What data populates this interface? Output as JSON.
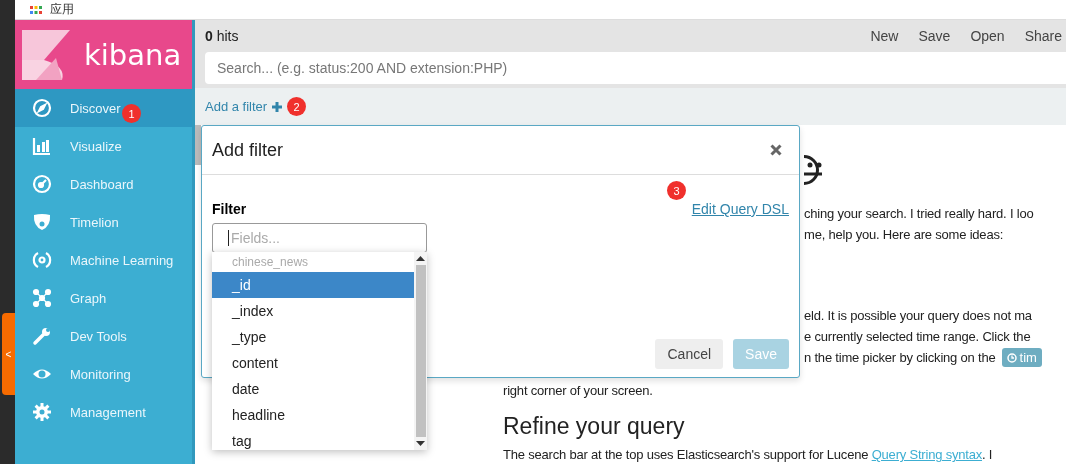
{
  "browser_bar": {
    "label": "应用"
  },
  "collapse_tab": {
    "label": "<"
  },
  "sidebar": {
    "logo": "kibana",
    "items": [
      {
        "label": "Discover",
        "selected": true,
        "badge": "1"
      },
      {
        "label": "Visualize",
        "selected": false
      },
      {
        "label": "Dashboard",
        "selected": false
      },
      {
        "label": "Timelion",
        "selected": false
      },
      {
        "label": "Machine Learning",
        "selected": false
      },
      {
        "label": "Graph",
        "selected": false
      },
      {
        "label": "Dev Tools",
        "selected": false
      },
      {
        "label": "Monitoring",
        "selected": false
      },
      {
        "label": "Management",
        "selected": false
      }
    ]
  },
  "top_bar": {
    "hits_count": "0",
    "hits_label": "hits",
    "actions": [
      "New",
      "Save",
      "Open",
      "Share"
    ]
  },
  "search": {
    "placeholder": "Search... (e.g. status:200 AND extension:PHP)"
  },
  "filter_bar": {
    "link": "Add a filter",
    "badge": "2"
  },
  "background_content": {
    "intro_lines": [
      "ching your search. I tried really hard. I loo",
      "me, help you. Here are some ideas:"
    ],
    "time_lines": [
      "eld. It is possible your query does not ma",
      "e currently selected time range. Click the",
      "n the time picker by clicking on the"
    ],
    "time_button": "tim",
    "time_last_line": "right corner of your screen.",
    "heading": "Refine your query",
    "refine_line": "The search bar at the top uses Elasticsearch's support for Lucene ",
    "refine_link": "Query String syntax",
    "refine_tail": ". I"
  },
  "modal": {
    "title": "Add filter",
    "label": "Filter",
    "dsl_link": "Edit Query DSL",
    "badge": "3",
    "field": {
      "placeholder": "Fields..."
    },
    "dropdown": {
      "group": "chinese_news",
      "options": [
        {
          "label": "_id",
          "selected": true
        },
        {
          "label": "_index",
          "selected": false
        },
        {
          "label": "_type",
          "selected": false
        },
        {
          "label": "content",
          "selected": false
        },
        {
          "label": "date",
          "selected": false
        },
        {
          "label": "headline",
          "selected": false
        },
        {
          "label": "tag",
          "selected": false
        }
      ]
    },
    "buttons": [
      {
        "label": "Cancel",
        "disabled": false
      },
      {
        "label": "Save",
        "disabled": true
      }
    ]
  }
}
